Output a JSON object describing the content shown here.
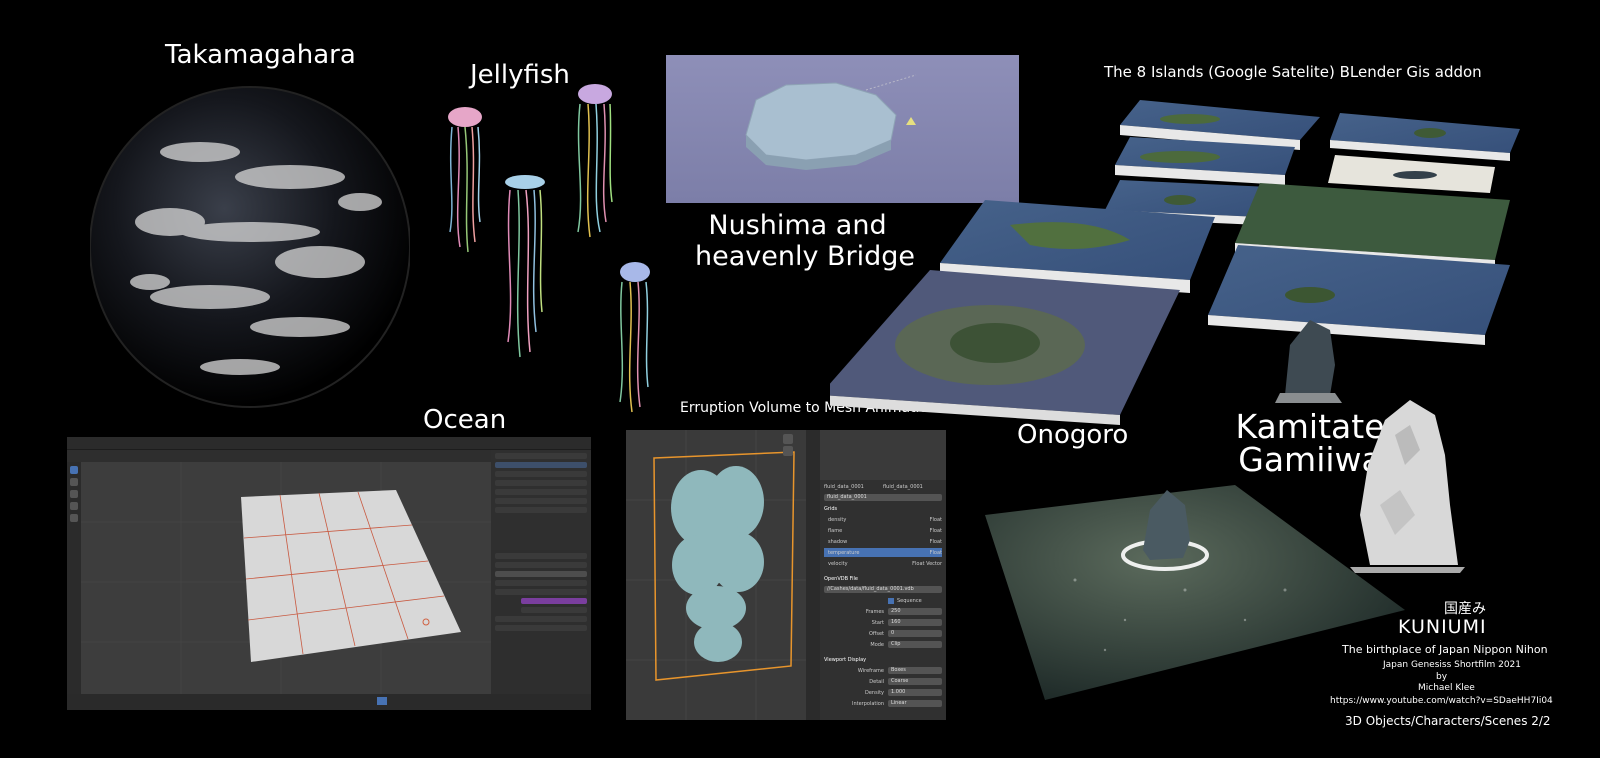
{
  "titles": {
    "takamagahara": "Takamagahara",
    "jellyfish": "Jellyfish",
    "nushima": "Nushima and\nheavenly Bridge",
    "islands": "The 8 Islands (Google Satelite) BLender Gis addon",
    "ocean": "Ocean",
    "eruption": "Erruption Volume to Mesh Animation",
    "onogoro": "Onogoro",
    "kamitate": "Kamitate\nGamiiwa"
  },
  "credits": {
    "japanese": "国産み",
    "kuniumi": "KUNIUMI",
    "subtitle": "The birthplace of Japan Nippon Nihon",
    "film": "Japan Genesiss Shortfilm 2021",
    "by": "by",
    "author": "Michael Klee",
    "url": "https://www.youtube.com/watch?v=SDaeHH7Ii04",
    "footer": "3D Objects/Characters/Scenes 2/2"
  },
  "blender_props": {
    "name_a": "fluid_data_0001",
    "name_b": "fluid_data_0001",
    "name_c": "fluid_data_0001",
    "grids_header": "Grids",
    "grids": [
      "density",
      "flame",
      "shadow",
      "temperature",
      "velocity"
    ],
    "grid_types": [
      "Float",
      "Float",
      "Float",
      "Float",
      "Float Vector"
    ],
    "openvdb_header": "OpenVDB File",
    "file_path": "//Cashes/data/fluid_data_0001.vdb",
    "sequence_label": "Sequence",
    "frames_label": "Frames",
    "frames_val": "250",
    "start_label": "Start",
    "start_val": "160",
    "offset_label": "Offset",
    "offset_val": "0",
    "mode_label": "Mode",
    "mode_val": "Clip",
    "viewport_header": "Viewport Display",
    "wireframe_label": "Wireframe",
    "wireframe_val": "Boxes",
    "detail_label": "Detail",
    "detail_val": "Coarse",
    "density_label": "Density",
    "density_val": "1.000",
    "interp_label": "Interpolation",
    "interp_val": "Linear"
  },
  "colors": {
    "background": "#000000",
    "volume_outline": "#e8952c",
    "ocean_wire": "#c8583f"
  }
}
